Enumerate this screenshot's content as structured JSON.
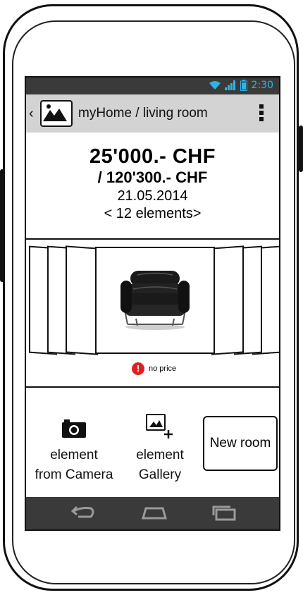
{
  "status": {
    "time": "2:30"
  },
  "appbar": {
    "title": "myHome / living room"
  },
  "summary": {
    "amount": "25'000.- CHF",
    "total": "/ 120'300.- CHF",
    "date": "21.05.2014",
    "elements": "< 12 elements>"
  },
  "gallery": {
    "price_note": "no price"
  },
  "actions": {
    "camera": {
      "line1": "element",
      "line2": "from Camera"
    },
    "gallery": {
      "line1": "element",
      "line2": "Gallery"
    },
    "new_room": "New room"
  },
  "icons": {
    "back": "chevron-left-icon",
    "app": "image-icon",
    "menu": "overflow-menu-icon",
    "camera": "camera-icon",
    "gallery_add": "image-add-icon",
    "warning": "warning-icon",
    "wifi": "wifi-icon",
    "signal": "signal-icon",
    "battery": "battery-icon"
  },
  "colors": {
    "accent": "#2fb3e6",
    "bars": "#3a3a3a",
    "appbar": "#d3d3d3",
    "warning": "#e02020"
  }
}
